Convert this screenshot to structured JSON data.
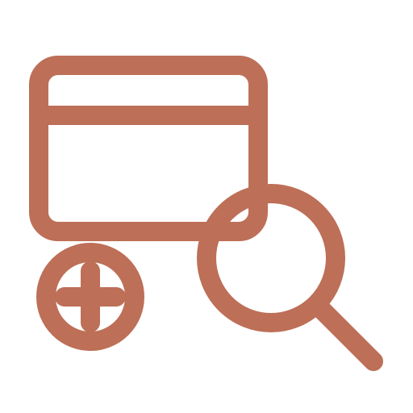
{
  "icon": {
    "name": "add-search-window-icon",
    "stroke_color": "#BD6F57",
    "background": "#FFFFFF",
    "parts": [
      "browser-window-icon",
      "plus-circle-icon",
      "magnifying-glass-icon"
    ]
  }
}
